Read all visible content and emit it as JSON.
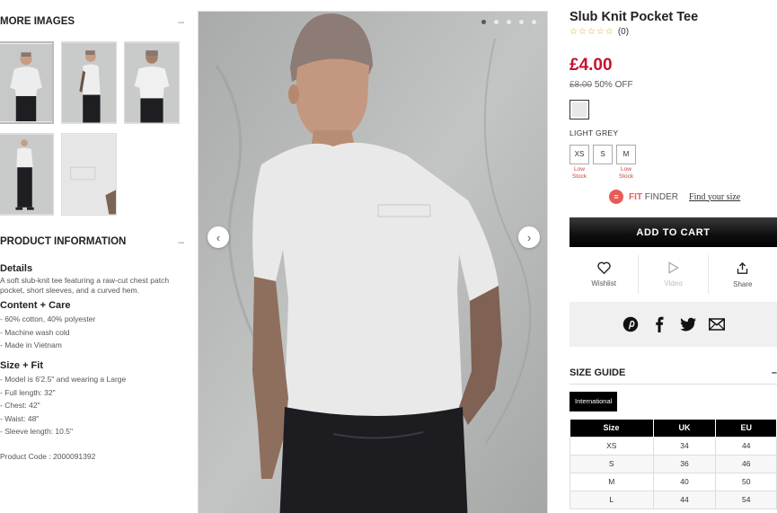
{
  "left": {
    "more_images": {
      "title": "MORE IMAGES",
      "toggle": "–"
    },
    "product_info": {
      "title": "PRODUCT INFORMATION",
      "toggle": "–",
      "details_title": "Details",
      "details_text": "A soft slub-knit tee featuring a raw-cut chest patch pocket, short sleeves, and a curved hem.",
      "content_title": "Content + Care",
      "content_items": [
        "- 60% cotton, 40% polyester",
        "- Machine wash cold",
        "- Made in Vietnam"
      ],
      "size_fit_title": "Size + Fit",
      "size_fit_items": [
        "- Model is 6'2.5\" and wearing a Large",
        "- Full length: 32\"",
        "- Chest: 42\"",
        "- Waist: 48\"",
        "- Sleeve length: 10.5\""
      ],
      "product_code": "Product Code : 2000091392"
    }
  },
  "gallery": {
    "prev_arrow": "‹",
    "next_arrow": "›",
    "dots": 5,
    "active_dot": 0
  },
  "product": {
    "title": "Slub Knit Pocket Tee",
    "stars": "☆☆☆☆☆",
    "review_count": "(0)",
    "price": "£4.00",
    "was_price": "£8.00",
    "discount": "50% OFF",
    "color_name": "LIGHT GREY",
    "sizes": [
      {
        "label": "XS",
        "stock": "Low Stock"
      },
      {
        "label": "S",
        "stock": ""
      },
      {
        "label": "M",
        "stock": "Low Stock"
      }
    ],
    "fit_finder": {
      "brand": "FIT",
      "name": "FINDER",
      "link": "Find your size"
    },
    "add_to_cart": "ADD TO CART",
    "actions": [
      {
        "label": "Wishlist",
        "icon": "heart-icon"
      },
      {
        "label": "Video",
        "icon": "play-icon"
      },
      {
        "label": "Share",
        "icon": "share-icon"
      }
    ]
  },
  "size_guide": {
    "title": "SIZE GUIDE",
    "toggle": "–",
    "tab": "International",
    "headers": [
      "Size",
      "UK",
      "EU"
    ],
    "rows": [
      [
        "XS",
        "34",
        "44"
      ],
      [
        "S",
        "36",
        "46"
      ],
      [
        "M",
        "40",
        "50"
      ],
      [
        "L",
        "44",
        "54"
      ]
    ]
  },
  "colors": {
    "price_red": "#c8102e",
    "fit_finder_red": "#e95b56",
    "low_stock": "#d0453b"
  }
}
